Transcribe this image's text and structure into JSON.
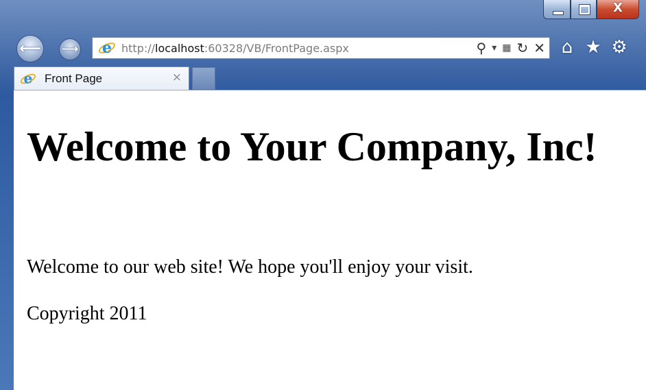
{
  "browser": {
    "address_bar": {
      "url_prefix": "http://",
      "url_host": "localhost",
      "url_rest": ":60328/VB/FrontPage.aspx"
    },
    "tab": {
      "title": "Front Page",
      "close_glyph": "×"
    },
    "caption_close_glyph": "X",
    "icons": {
      "back": "back-arrow-icon",
      "forward": "forward-arrow-icon",
      "page": "internet-explorer-icon",
      "search": "search-icon",
      "dropdown": "chevron-down-icon",
      "compat": "compatibility-view-icon",
      "refresh": "refresh-icon",
      "stop": "stop-icon",
      "home": "home-icon",
      "favorites": "star-icon",
      "tools": "gear-icon"
    },
    "colors": {
      "frame": "#2d5aa0",
      "close_button": "#c8402a",
      "ie_logo": "#2a8fd8"
    }
  },
  "page": {
    "heading": "Welcome to Your Company, Inc!",
    "welcome_text": "Welcome to our web site! We hope you'll enjoy your visit.",
    "copyright": "Copyright 2011"
  }
}
